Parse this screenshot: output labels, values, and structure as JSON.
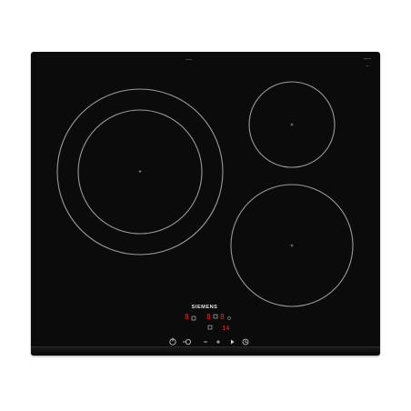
{
  "product": {
    "brand": "SIEMENS",
    "type": "induction cooktop",
    "colors": {
      "background": "#ffffff",
      "glass": "#0b0b0b",
      "ring_lines": "#9a9a9a",
      "display_red": "#e8232a",
      "text_grey": "#b8b8b8"
    }
  },
  "zones": [
    {
      "id": "zone-large-left",
      "rings": 2
    },
    {
      "id": "zone-small-top-right",
      "rings": 1
    },
    {
      "id": "zone-medium-bottom-right",
      "rings": 1
    }
  ],
  "display": {
    "digits": [
      "8",
      "8",
      "8",
      "14"
    ]
  },
  "controls": [
    {
      "name": "power-icon",
      "glyph": "power"
    },
    {
      "name": "boost-icon",
      "glyph": "boost"
    },
    {
      "name": "minus-icon",
      "glyph": "minus"
    },
    {
      "name": "plus-icon",
      "glyph": "plus"
    },
    {
      "name": "play-icon",
      "glyph": "play"
    },
    {
      "name": "timer-icon",
      "glyph": "timer"
    }
  ]
}
